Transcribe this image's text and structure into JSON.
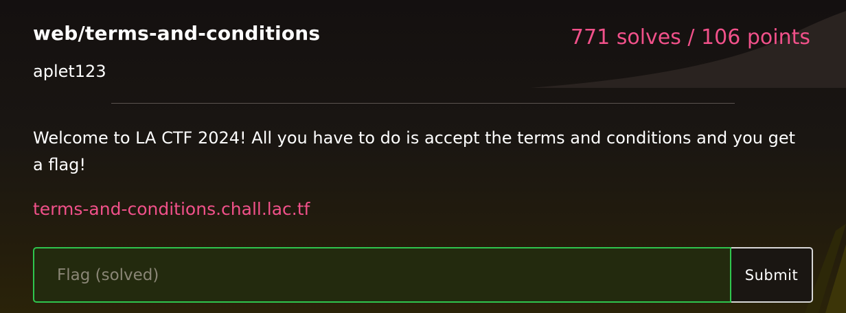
{
  "challenge": {
    "title": "web/terms-and-conditions",
    "author": "aplet123",
    "stats": "771 solves / 106 points",
    "description": "Welcome to LA CTF 2024! All you have to do is accept the terms and conditions and you get a flag!",
    "link": "terms-and-conditions.chall.lac.tf"
  },
  "flag_form": {
    "placeholder": "Flag (solved)",
    "value": "",
    "submit_label": "Submit"
  },
  "colors": {
    "accent_pink": "#f1518a",
    "solved_green": "#2fc64e",
    "background": "#1a1612"
  }
}
